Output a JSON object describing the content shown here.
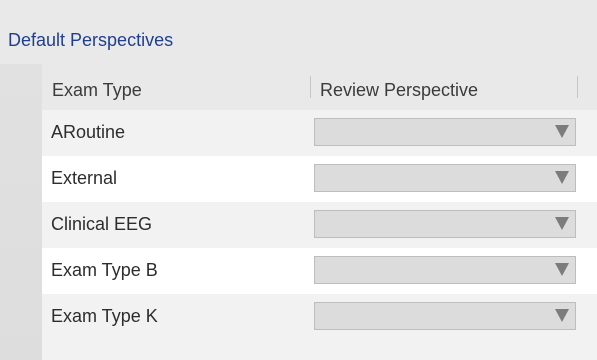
{
  "section": {
    "title": "Default Perspectives"
  },
  "table": {
    "columns": [
      "Exam Type",
      "Review Perspective"
    ],
    "rows": [
      {
        "exam_type": "ARoutine",
        "perspective": ""
      },
      {
        "exam_type": "External",
        "perspective": ""
      },
      {
        "exam_type": "Clinical EEG",
        "perspective": ""
      },
      {
        "exam_type": "Exam Type B",
        "perspective": ""
      },
      {
        "exam_type": "Exam Type K",
        "perspective": ""
      }
    ]
  },
  "icons": {
    "dropdown": "chevron-down-icon"
  },
  "colors": {
    "title": "#1f3f8f",
    "select_bg": "#dcdcdc",
    "arrow": "#7c7c7c"
  }
}
